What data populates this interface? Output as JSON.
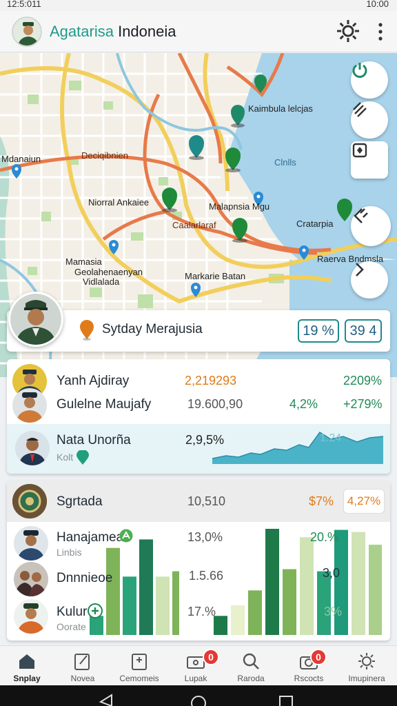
{
  "status_bar": {
    "time_left": "12:5:011",
    "time_right": "10:00"
  },
  "app_bar": {
    "title_accent": "Agatarisa",
    "title_rest": "Indoneia"
  },
  "map": {
    "labels": [
      "Mdanaiun",
      "Kaimbula lelcjas",
      "Deciqibnien",
      "Clnlls",
      "Niorral Ankaiee",
      "Malapnsia Mgu",
      "Cratarpia",
      "Caalarlaraf",
      "Mamasia",
      "Geolahenaenyan",
      "Vidlalada",
      "Markarie Batan",
      "Raerva Bndmsla"
    ],
    "fabs": [
      "power-icon",
      "layers-icon",
      "compass-icon",
      "collapse-icon",
      "chevron-right-icon"
    ]
  },
  "location_card": {
    "title": "Sytday Merajusia",
    "badge1": "19 %",
    "badge2": "39 4"
  },
  "list1": {
    "rows": [
      {
        "name": "Yanh Ajdiray",
        "value": "2,219293",
        "change": "2209%"
      },
      {
        "name": "Gulelne Maujafy",
        "value": "19.600,90",
        "change1": "4,2%",
        "change2": "+279%"
      }
    ],
    "highlight": {
      "name": "Nata Unorña",
      "sub": "Kolt",
      "value": "2,9,5%",
      "chart_label": "1.24"
    }
  },
  "list2": {
    "header": {
      "name": "Sgrtada",
      "value": "10,510",
      "change": "$7%",
      "badge": "4,27%"
    },
    "rows": [
      {
        "name": "Hanajamea",
        "sub": "Linbis",
        "value": "13,0%",
        "right_value": "20.%"
      },
      {
        "name": "Dnnnieoe",
        "value": "1.5.66",
        "right_value": "3,0"
      },
      {
        "name": "Kulur",
        "sub": "Oorate",
        "value": "17.%",
        "right_value": "3%"
      }
    ],
    "bars_left": [
      0.18,
      0.82,
      0.55,
      0.9,
      0.55,
      0.6
    ],
    "bars_right": [
      0.18,
      0.28,
      0.42,
      1.0,
      0.62,
      0.92,
      0.6,
      0.99,
      0.97,
      0.85
    ]
  },
  "bottom_nav": {
    "items": [
      {
        "label": "Snplay",
        "icon": "home-icon"
      },
      {
        "label": "Novea",
        "icon": "edit-icon"
      },
      {
        "label": "Cemomeis",
        "icon": "clipboard-icon"
      },
      {
        "label": "Lupak",
        "icon": "wallet-icon",
        "badge": "0"
      },
      {
        "label": "Raroda",
        "icon": "search-icon"
      },
      {
        "label": "Rscocts",
        "icon": "camera-icon",
        "badge": "0"
      },
      {
        "label": "Imupinera",
        "icon": "sun-icon"
      }
    ]
  },
  "colors": {
    "accent": "#1f9a8a",
    "orange": "#e07b1a",
    "green": "#1f8a55"
  }
}
